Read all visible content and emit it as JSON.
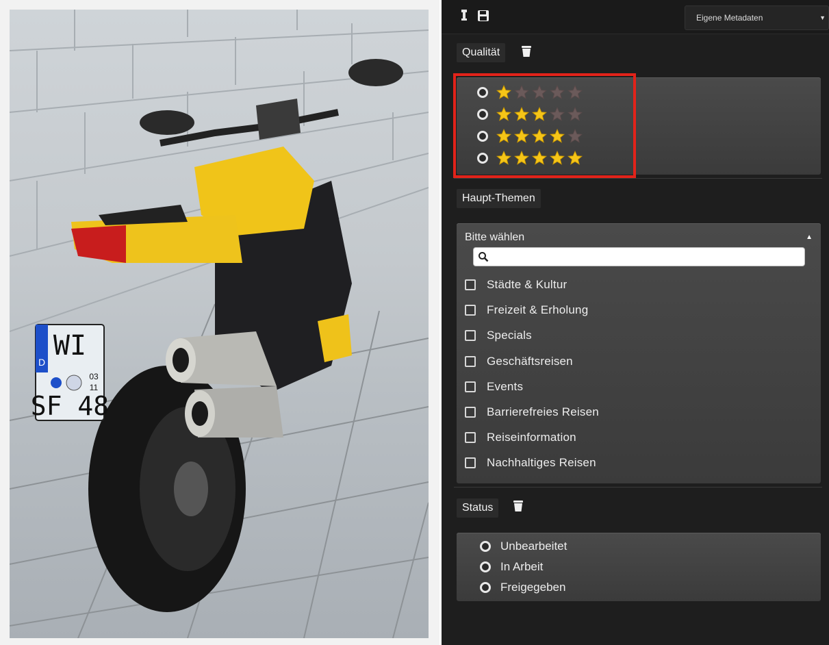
{
  "toolbar": {
    "tool1_icon": "wand-icon",
    "tool2_icon": "save-icon",
    "metadata_select": "Eigene Metadaten"
  },
  "quality": {
    "label": "Qualität",
    "ratings": [
      {
        "filled": 1,
        "of": 5
      },
      {
        "filled": 3,
        "of": 5
      },
      {
        "filled": 4,
        "of": 5
      },
      {
        "filled": 5,
        "of": 5
      }
    ]
  },
  "topics": {
    "label": "Haupt-Themen",
    "placeholder": "Bitte wählen",
    "search_value": "",
    "options": [
      "Städte & Kultur",
      "Freizeit & Erholung",
      "Specials",
      "Geschäftsreisen",
      "Events",
      "Barrierefreies Reisen",
      "Reiseinformation",
      "Nachhaltiges Reisen"
    ]
  },
  "status": {
    "label": "Status",
    "options": [
      "Unbearbeitet",
      "In Arbeit",
      "Freigegeben"
    ]
  },
  "photo": {
    "plate_line1": "WI",
    "plate_line2": "SF 48",
    "plate_country": "D",
    "plate_month": "03",
    "plate_year": "11"
  },
  "colors": {
    "accent_highlight": "#e2231a",
    "star_filled": "#f5c518",
    "star_empty": "#6b5a5a",
    "panel_bg": "#1e1e1e"
  }
}
